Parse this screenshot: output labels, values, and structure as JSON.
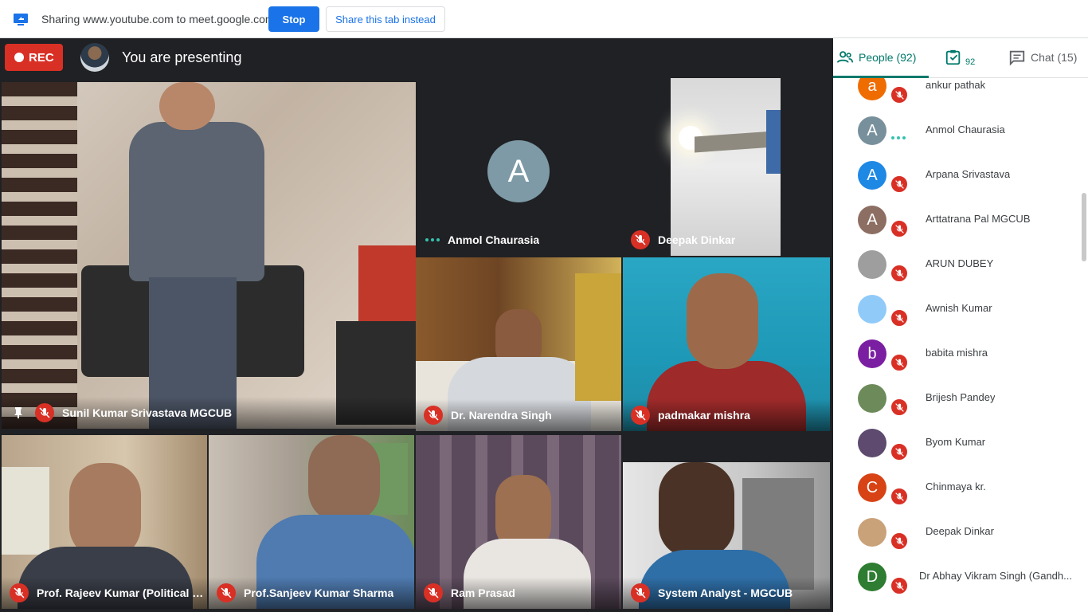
{
  "sharebar": {
    "text": "Sharing www.youtube.com to meet.google.com",
    "stop_label": "Stop",
    "share_tab_label": "Share this tab instead"
  },
  "meet": {
    "rec_label": "REC",
    "presenting_text": "You are presenting",
    "tiles": [
      {
        "name": "Sunil Kumar Srivastava MGCUB"
      },
      {
        "name": "Anmol Chaurasia",
        "avatar_letter": "A"
      },
      {
        "name": "Deepak Dinkar"
      },
      {
        "name": "Dr. Narendra Singh"
      },
      {
        "name": "padmakar mishra"
      },
      {
        "name": "Prof. Rajeev Kumar (Political Scie..."
      },
      {
        "name": "Prof.Sanjeev Kumar Sharma"
      },
      {
        "name": "Ram Prasad"
      },
      {
        "name": "System Analyst - MGCUB"
      }
    ]
  },
  "panel": {
    "people_tab": "People (92)",
    "tasks_count": "92",
    "chat_tab": "Chat (15)",
    "participants": [
      {
        "letter": "a",
        "name": "ankur pathak",
        "color": "#ef6c00"
      },
      {
        "letter": "A",
        "name": "Anmol Chaurasia",
        "color": "#78909c",
        "speaking": true
      },
      {
        "letter": "A",
        "name": "Arpana Srivastava",
        "color": "#1e88e5"
      },
      {
        "letter": "A",
        "name": "Arttatrana Pal MGCUB",
        "color": "#8d6e63"
      },
      {
        "letter": "",
        "name": "ARUN DUBEY",
        "color": "#9e9e9e"
      },
      {
        "letter": "",
        "name": "Awnish Kumar",
        "color": "#90caf9"
      },
      {
        "letter": "b",
        "name": "babita mishra",
        "color": "#7b1fa2"
      },
      {
        "letter": "",
        "name": "Brijesh Pandey",
        "color": "#6d8b5a"
      },
      {
        "letter": "",
        "name": "Byom Kumar",
        "color": "#5d4a6e"
      },
      {
        "letter": "C",
        "name": "Chinmaya kr.",
        "color": "#d84315"
      },
      {
        "letter": "",
        "name": "Deepak Dinkar",
        "color": "#c9a27a"
      },
      {
        "letter": "D",
        "name": "Dr Abhay Vikram Singh (Gandh...",
        "color": "#2e7d32"
      }
    ]
  }
}
